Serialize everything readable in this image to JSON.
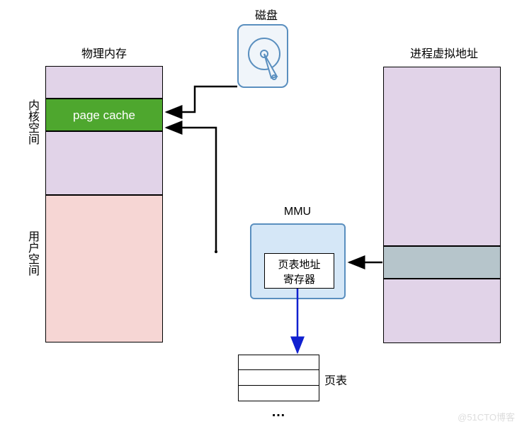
{
  "titles": {
    "disk": "磁盘",
    "physical_memory": "物理内存",
    "virtual_address": "进程虚拟地址",
    "kernel_space": "内核空间",
    "user_space": "用户空间",
    "page_cache": "page cache",
    "mmu": "MMU",
    "page_table_register": "页表地址寄存器",
    "page_table": "页表",
    "ellipsis": "…"
  },
  "colors": {
    "purple_light": "#e1d3e8",
    "green": "#4ea72e",
    "pink": "#f6d6d4",
    "blue_light": "#d5e7f7",
    "gray_blue": "#b6c5cb"
  },
  "watermark": "@51CTO博客"
}
